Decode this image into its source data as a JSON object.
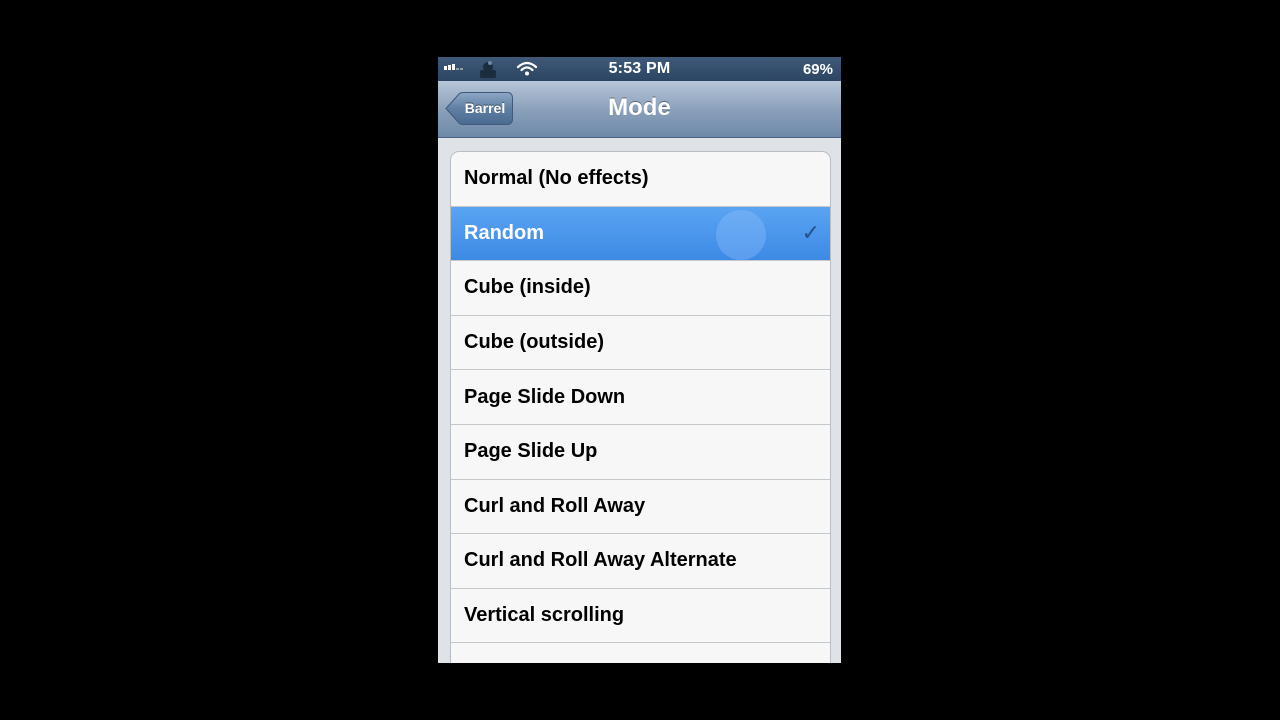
{
  "status_bar": {
    "time": "5:53 PM",
    "battery": "69%",
    "icons": [
      "signal-icon",
      "carrier-icon",
      "wifi-icon"
    ]
  },
  "nav": {
    "back_label": "Barrel",
    "title": "Mode"
  },
  "list": {
    "items": [
      {
        "label": "Normal (No effects)",
        "selected": false
      },
      {
        "label": "Random",
        "selected": true
      },
      {
        "label": "Cube (inside)",
        "selected": false
      },
      {
        "label": "Cube (outside)",
        "selected": false
      },
      {
        "label": "Page Slide Down",
        "selected": false
      },
      {
        "label": "Page Slide Up",
        "selected": false
      },
      {
        "label": "Curl and Roll Away",
        "selected": false
      },
      {
        "label": "Curl and Roll Away Alternate",
        "selected": false
      },
      {
        "label": "Vertical scrolling",
        "selected": false
      },
      {
        "label": "",
        "selected": false
      }
    ],
    "checkmark": "✓"
  },
  "colors": {
    "selected_row": "#3d8ae6",
    "nav_bar": "#8ba1bb",
    "status_bar": "#2b4563"
  }
}
